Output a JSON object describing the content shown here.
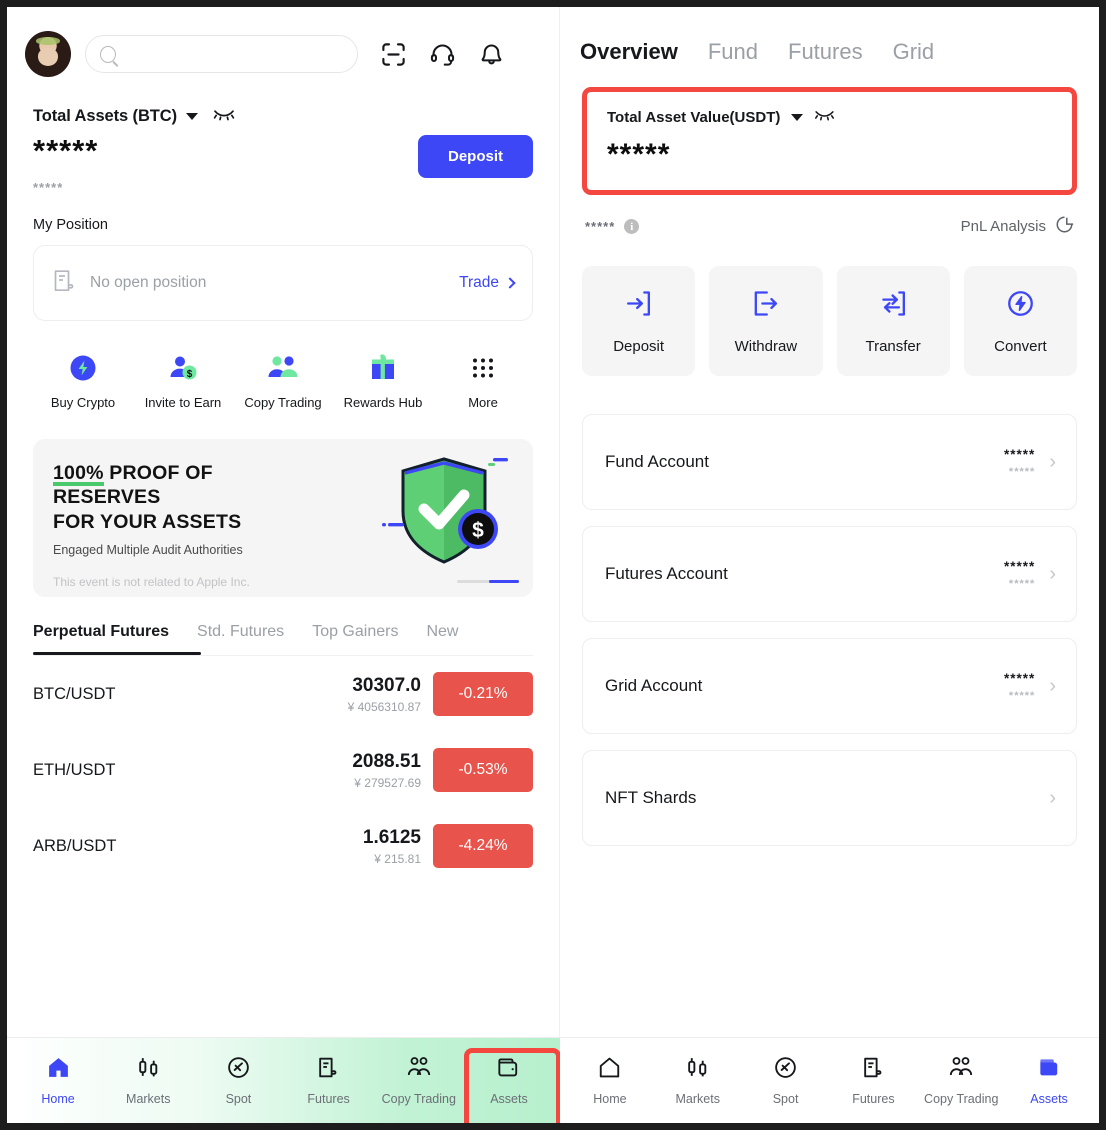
{
  "left": {
    "search": {
      "placeholder": "",
      "value": "",
      "icon": "search-icon"
    },
    "header_icons": [
      "scan-icon",
      "headset-support-icon",
      "bell-notification-icon"
    ],
    "avatar": "user-avatar",
    "total_assets": {
      "label": "Total Assets (BTC)",
      "caret": "chevron-down-icon",
      "eye": "eye-closed-icon",
      "amount": "*****",
      "sub_amount": "*****",
      "deposit_label": "Deposit"
    },
    "my_position": {
      "title": "My Position",
      "empty_text": "No open position",
      "trade_label": "Trade",
      "icon": "document-position-icon"
    },
    "quick_actions": [
      {
        "label": "Buy Crypto",
        "icon": "lightning-circle-icon"
      },
      {
        "label": "Invite to Earn",
        "icon": "invite-person-dollar-icon"
      },
      {
        "label": "Copy Trading",
        "icon": "two-people-icon"
      },
      {
        "label": "Rewards Hub",
        "icon": "gift-box-icon"
      },
      {
        "label": "More",
        "icon": "grid-dots-icon"
      }
    ],
    "promo": {
      "headline_pct": "100%",
      "headline_rest": " PROOF OF",
      "headline_line2": "RESERVES",
      "headline_line3": "FOR YOUR ASSETS",
      "subtitle": "Engaged Multiple Audit Authorities",
      "disclaimer": "This event is not related to Apple Inc.",
      "art": "green-shield-check-dollar-illustration"
    },
    "market_tabs": [
      {
        "label": "Perpetual Futures",
        "active": true
      },
      {
        "label": "Std. Futures",
        "active": false
      },
      {
        "label": "Top Gainers",
        "active": false
      },
      {
        "label": "New",
        "active": false
      }
    ],
    "market_rows": [
      {
        "pair": "BTC/USDT",
        "price": "30307.0",
        "cny": "¥ 4056310.87",
        "change": "-0.21%"
      },
      {
        "pair": "ETH/USDT",
        "price": "2088.51",
        "cny": "¥ 279527.69",
        "change": "-0.53%"
      },
      {
        "pair": "ARB/USDT",
        "price": "1.6125",
        "cny": "¥ 215.81",
        "change": "-4.24%"
      }
    ],
    "bottom_nav": [
      {
        "label": "Home",
        "icon": "home-icon",
        "active": true
      },
      {
        "label": "Markets",
        "icon": "candlestick-icon",
        "active": false
      },
      {
        "label": "Spot",
        "icon": "spot-circle-icon",
        "active": false
      },
      {
        "label": "Futures",
        "icon": "futures-document-icon",
        "active": false
      },
      {
        "label": "Copy Trading",
        "icon": "two-people-icon",
        "active": false
      },
      {
        "label": "Assets",
        "icon": "wallet-icon",
        "active": false
      }
    ]
  },
  "right": {
    "tabs": [
      {
        "label": "Overview",
        "active": true
      },
      {
        "label": "Fund",
        "active": false
      },
      {
        "label": "Futures",
        "active": false
      },
      {
        "label": "Grid",
        "active": false
      }
    ],
    "total_asset_value": {
      "label": "Total Asset Value(USDT)",
      "caret": "chevron-down-icon",
      "eye": "eye-closed-icon",
      "amount": "*****"
    },
    "pnl": {
      "stars": "*****",
      "info_icon": "info-icon",
      "analysis_label": "PnL Analysis",
      "analysis_icon": "pie-chart-icon"
    },
    "actions": [
      {
        "label": "Deposit",
        "icon": "deposit-arrow-in-icon"
      },
      {
        "label": "Withdraw",
        "icon": "withdraw-arrow-out-icon"
      },
      {
        "label": "Transfer",
        "icon": "transfer-arrows-icon"
      },
      {
        "label": "Convert",
        "icon": "convert-lightning-circle-icon"
      }
    ],
    "accounts": [
      {
        "name": "Fund Account",
        "v1": "*****",
        "v2": "*****"
      },
      {
        "name": "Futures Account",
        "v1": "*****",
        "v2": "*****"
      },
      {
        "name": "Grid Account",
        "v1": "*****",
        "v2": "*****"
      },
      {
        "name": "NFT Shards",
        "v1": "",
        "v2": ""
      }
    ],
    "bottom_nav": [
      {
        "label": "Home",
        "icon": "home-icon",
        "active": false
      },
      {
        "label": "Markets",
        "icon": "candlestick-icon",
        "active": false
      },
      {
        "label": "Spot",
        "icon": "spot-circle-icon",
        "active": false
      },
      {
        "label": "Futures",
        "icon": "futures-document-icon",
        "active": false
      },
      {
        "label": "Copy Trading",
        "icon": "two-people-icon",
        "active": false
      },
      {
        "label": "Assets",
        "icon": "wallet-icon",
        "active": true
      }
    ]
  },
  "colors": {
    "accent_blue": "#3d47f5",
    "highlight_red": "#f4473f",
    "negative_red": "#e8544c",
    "green": "#49c96b",
    "mint_wash": "#b7f0cd"
  }
}
